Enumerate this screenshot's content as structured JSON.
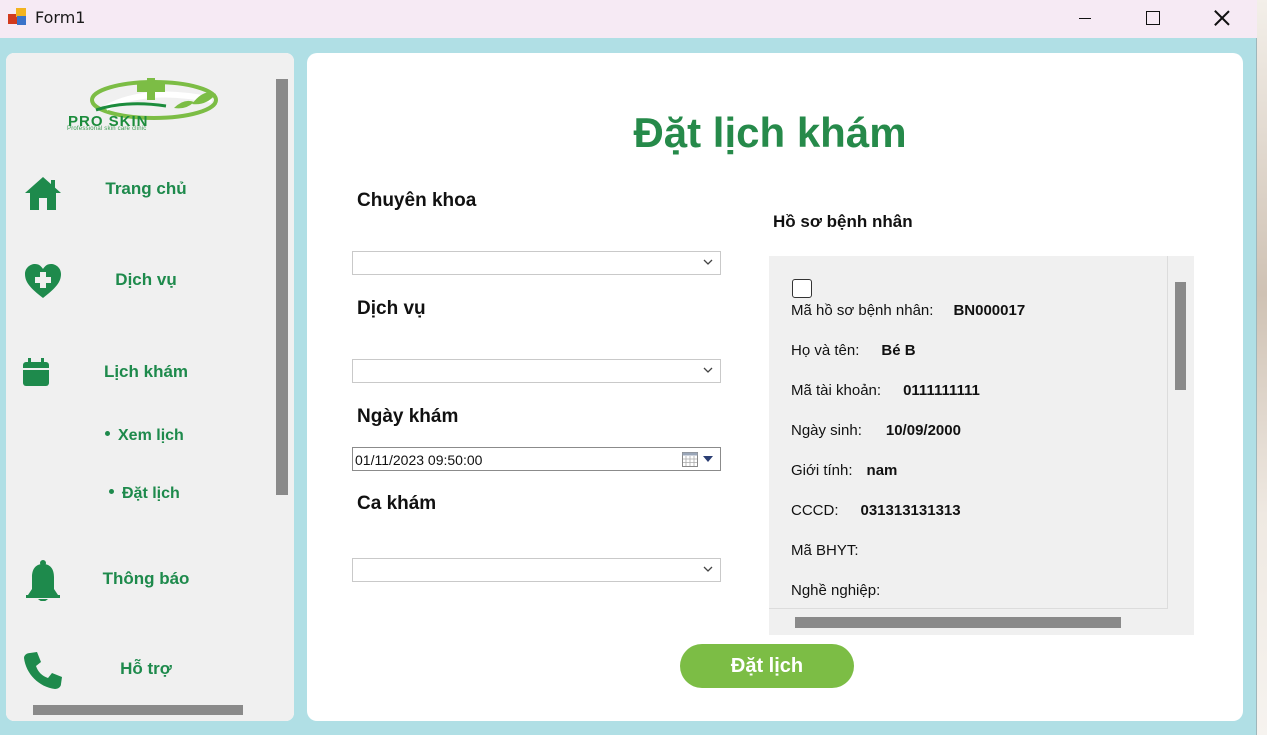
{
  "window": {
    "title": "Form1"
  },
  "sidebar": {
    "logo": {
      "text": "PRO SKIN",
      "subtitle": "Professional skin care clinic"
    },
    "items": [
      {
        "label": "Trang chủ",
        "icon": "home-icon"
      },
      {
        "label": "Dịch vụ",
        "icon": "heart-plus-icon"
      },
      {
        "label": "Lịch khám",
        "icon": "calendar-icon"
      },
      {
        "label": "Thông báo",
        "icon": "bell-icon"
      },
      {
        "label": "Hỗ trợ",
        "icon": "phone-icon"
      }
    ],
    "subitems": [
      {
        "label": "Xem lịch"
      },
      {
        "label": "Đặt lịch"
      }
    ]
  },
  "main": {
    "title": "Đặt lịch khám",
    "fields": {
      "specialty_label": "Chuyên khoa",
      "specialty_value": "",
      "service_label": "Dịch vụ",
      "service_value": "",
      "date_label": "Ngày khám",
      "date_value": "01/11/2023 09:50:00",
      "shift_label": "Ca khám",
      "shift_value": ""
    },
    "profile": {
      "title": "Hồ sơ bệnh nhân",
      "checked": false,
      "rows": [
        {
          "key": "Mã hồ sơ bệnh nhân:",
          "value": "BN000017"
        },
        {
          "key": "Họ và tên:",
          "value": "Bé B"
        },
        {
          "key": "Mã tài khoản:",
          "value": "0111111111"
        },
        {
          "key": "Ngày sinh:",
          "value": "10/09/2000"
        },
        {
          "key": "Giới tính:",
          "value": "nam"
        },
        {
          "key": "CCCD:",
          "value": "031313131313"
        },
        {
          "key": "Mã BHYT:",
          "value": ""
        },
        {
          "key": "Nghề nghiệp:",
          "value": ""
        }
      ]
    },
    "book_button": "Đặt lịch"
  },
  "colors": {
    "brand_green": "#268a4a",
    "nav_green": "#1e8a4c",
    "button_green": "#7cbd45",
    "window_bg": "#b0dfe5",
    "titlebar_bg": "#f6eaf4"
  }
}
